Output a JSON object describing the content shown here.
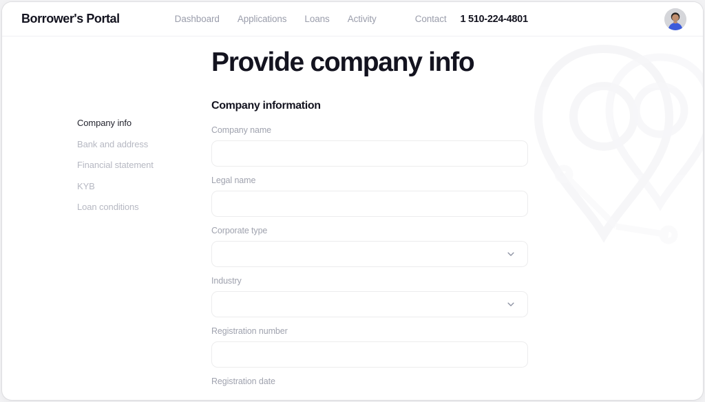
{
  "header": {
    "brand": "Borrower's Portal",
    "nav": [
      {
        "label": "Dashboard"
      },
      {
        "label": "Applications"
      },
      {
        "label": "Loans"
      },
      {
        "label": "Activity"
      }
    ],
    "contact_label": "Contact",
    "phone": "1 510-224-4801",
    "avatar_icon": "user-avatar-photo"
  },
  "page": {
    "title": "Provide company info"
  },
  "step_nav": {
    "items": [
      {
        "label": "Company info",
        "active": true
      },
      {
        "label": "Bank and address",
        "active": false
      },
      {
        "label": "Financial statement",
        "active": false
      },
      {
        "label": "KYB",
        "active": false
      },
      {
        "label": "Loan conditions",
        "active": false
      }
    ]
  },
  "form": {
    "section_heading": "Company information",
    "fields": [
      {
        "label": "Company name",
        "type": "text",
        "value": "",
        "placeholder": ""
      },
      {
        "label": "Legal name",
        "type": "text",
        "value": "",
        "placeholder": ""
      },
      {
        "label": "Corporate type",
        "type": "select",
        "value": "",
        "icon": "chevron-down-icon"
      },
      {
        "label": "Industry",
        "type": "select",
        "value": "",
        "icon": "chevron-down-icon"
      },
      {
        "label": "Registration number",
        "type": "text",
        "value": "",
        "placeholder": ""
      },
      {
        "label": "Registration date",
        "type": "text",
        "value": "",
        "placeholder": "",
        "clipped": true
      }
    ]
  },
  "colors": {
    "ink": "#13131f",
    "muted": "#9fa2ae",
    "step_inactive": "#b6b8c2",
    "border": "#ececed",
    "surface": "#ffffff",
    "backdrop": "#f2f2f4",
    "avatar_shirt": "#3b5bdb"
  }
}
